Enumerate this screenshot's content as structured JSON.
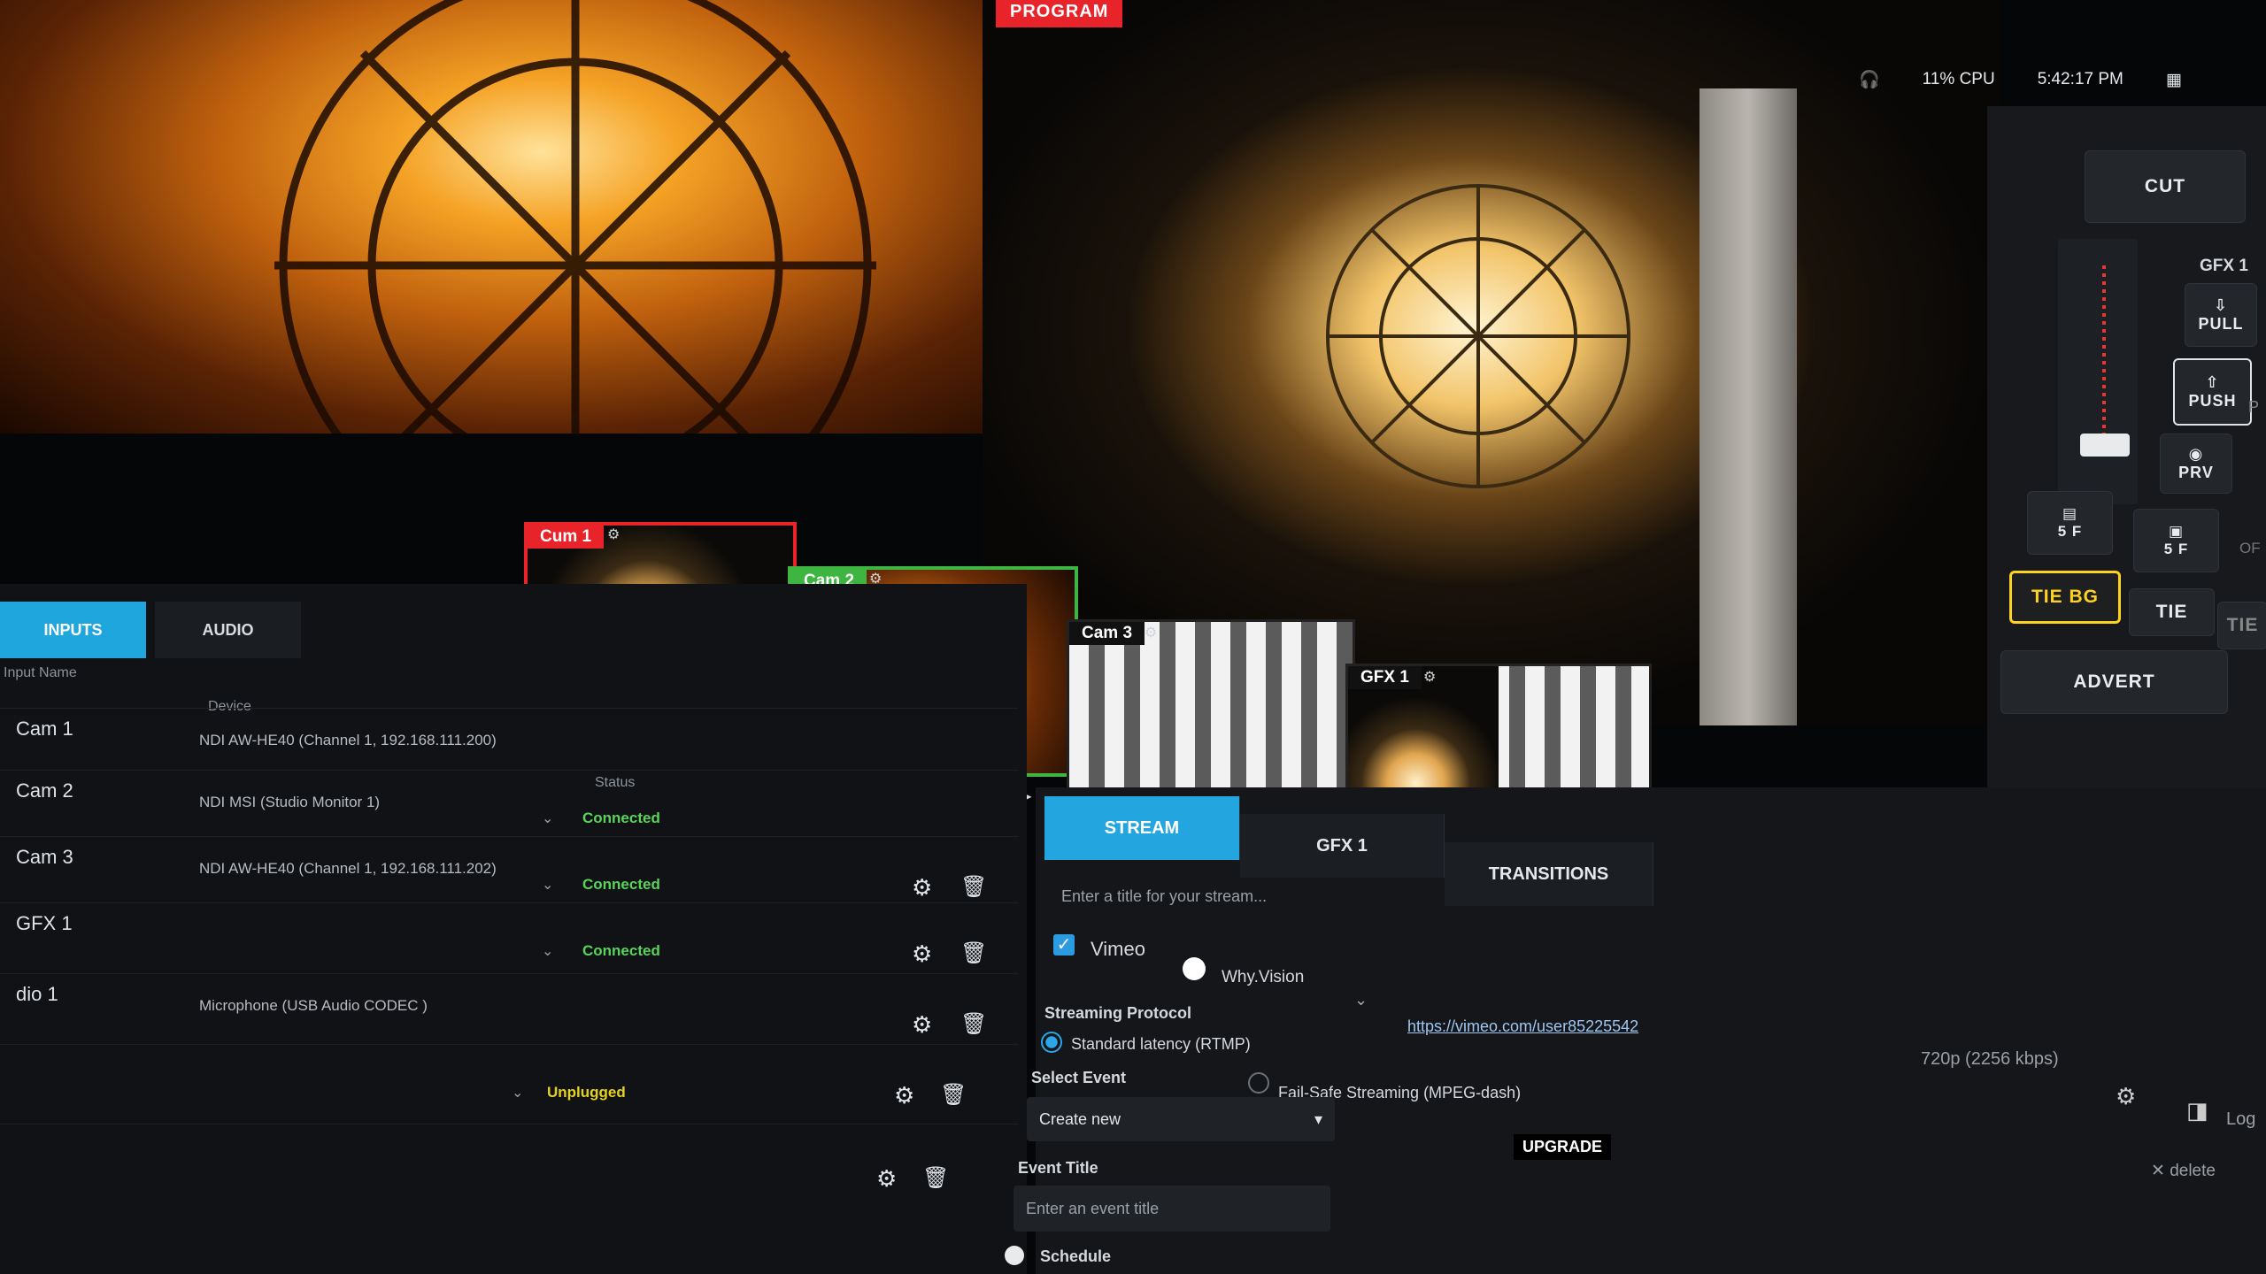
{
  "program_label": "PROGRAM",
  "topbar": {
    "cpu": "11% CPU",
    "time": "5:42:17 PM"
  },
  "controls": {
    "cut": "CUT",
    "gfx_label": "GFX 1",
    "pull": "PULL",
    "push": "PUSH",
    "prv": "PRV",
    "frames_bg": "5 F",
    "frames_gfx": "5 F",
    "tie_bg": "TIE BG",
    "tie": "TIE",
    "tie_extra": "TIE",
    "advert": "ADVERT",
    "off_partial": "OF",
    "p_partial": "P"
  },
  "multiview": [
    {
      "label": "Cum 1",
      "border": "#e8232a"
    },
    {
      "label": "Cam 2",
      "border": "#3db540"
    },
    {
      "label": "Cam 3",
      "border": "#222"
    },
    {
      "label": "GFX 1",
      "border": "#222"
    }
  ],
  "tabs": {
    "inputs": "INPUTS",
    "audio": "AUDIO"
  },
  "columns": {
    "input_name": "Input Name",
    "device": "Device",
    "status": "Status"
  },
  "inputs": [
    {
      "name": "Cam 1",
      "device": "NDI AW-HE40 (Channel 1, 192.168.111.200)",
      "status": "",
      "status_color": "#59d35a"
    },
    {
      "name": "Cam 2",
      "device": "NDI MSI (Studio Monitor 1)",
      "status": "Connected",
      "status_color": "#59d35a"
    },
    {
      "name": "Cam 3",
      "device": "NDI AW-HE40 (Channel 1, 192.168.111.202)",
      "status": "Connected",
      "status_color": "#59d35a"
    },
    {
      "name": "GFX 1",
      "device": "",
      "status": "Connected",
      "status_color": "#59d35a"
    },
    {
      "name": "dio 1",
      "device": "Microphone (USB Audio CODEC )",
      "status": "",
      "status_color": "#59d35a"
    },
    {
      "name": "",
      "device": "",
      "status": "Unplugged",
      "status_color": "#e6d21a"
    }
  ],
  "stream_tabs": {
    "stream": "STREAM",
    "gfx": "GFX 1",
    "transitions": "TRANSITIONS"
  },
  "stream": {
    "title_placeholder": "Enter a title for your stream...",
    "platform": "Vimeo",
    "account": "Why.Vision",
    "url": "https://vimeo.com/user85225542",
    "quality": "720p (2256 kbps)",
    "log": "Log",
    "protocol_label": "Streaming Protocol",
    "protocol_rtmp": "Standard latency (RTMP)",
    "protocol_dash": "Fail-Safe Streaming (MPEG-dash)",
    "upgrade": "UPGRADE",
    "select_event_label": "Select Event",
    "select_event_value": "Create new",
    "event_title_label": "Event Title",
    "event_title_placeholder": "Enter an event title",
    "delete": "delete",
    "schedule": "Schedule"
  }
}
